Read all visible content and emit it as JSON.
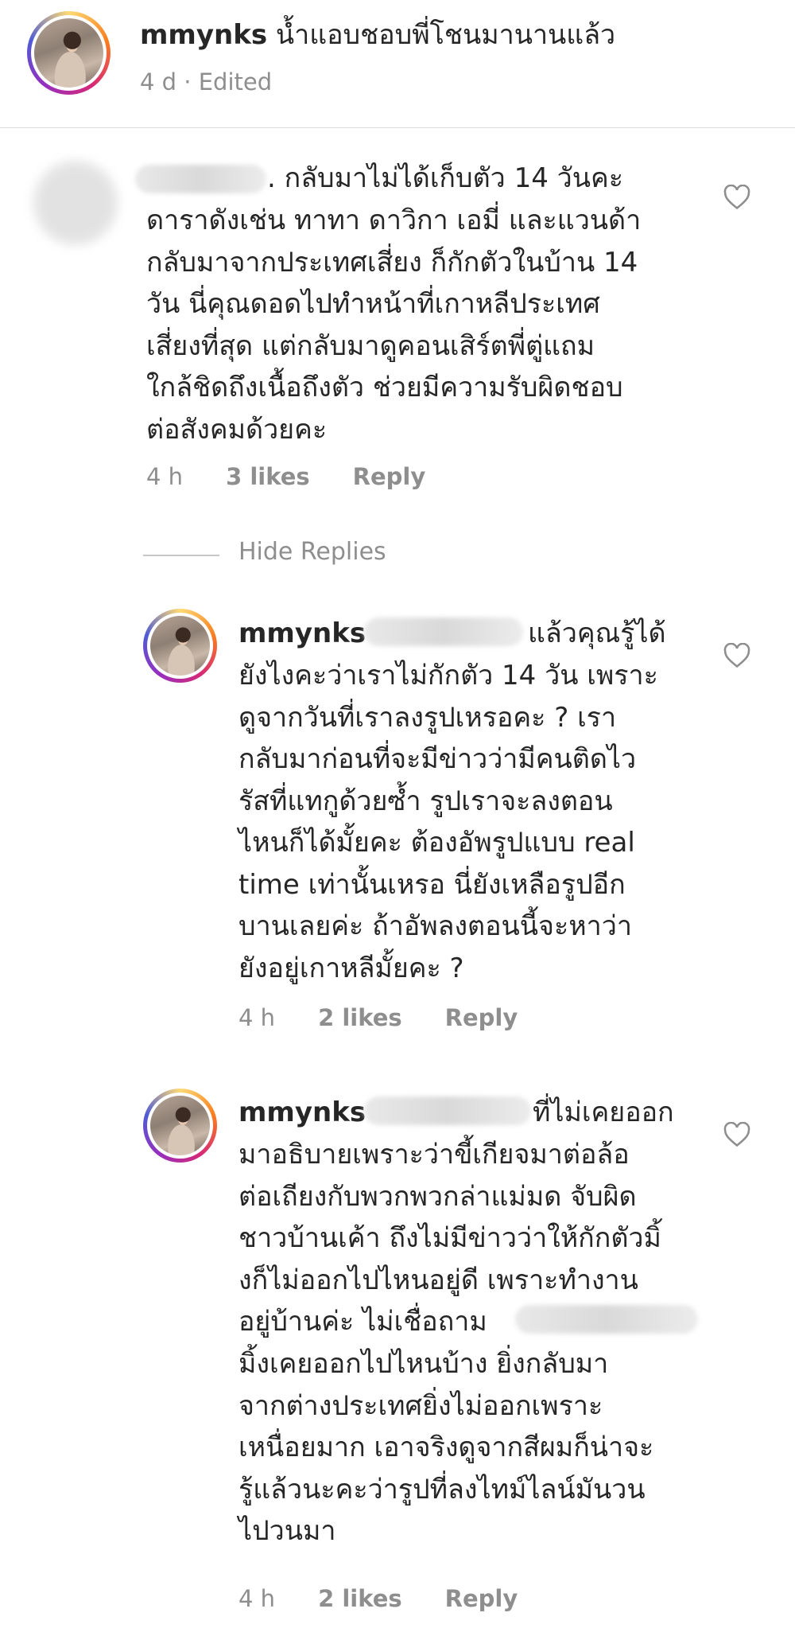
{
  "caption": {
    "username": "mmynks",
    "text": "น้ำแอบชอบพี่โชนมานานแล้ว",
    "time": "4 d",
    "edited": "Edited",
    "separator": " · "
  },
  "comments": [
    {
      "username": "",
      "line1": ". กลับมาไม่ได้เก็บตัว 14 วันคะ",
      "body": "ดาราดังเช่น ทาทา ดาวิกา เอมี่ และแวนด้า\nกลับมาจากประเทศเสี่ยง ก็กักตัวในบ้าน 14\nวัน นี่คุณดอดไปทำหน้าที่เกาหลีประเทศ\nเสี่ยงที่สุด แต่กลับมาดูคอนเสิร์ตพี่ตู่แถม\nใกล้ชิดถึงเนื้อถึงตัว ช่วยมีความรับผิดชอบ\nต่อสังคมด้วยคะ",
      "time": "4 h",
      "likes": "3 likes",
      "reply": "Reply"
    }
  ],
  "hide_replies": "Hide Replies",
  "replies": [
    {
      "username": "mmynks",
      "line1": "แล้วคุณรู้ได้",
      "body": "ยังไงคะว่าเราไม่กักตัว 14 วัน เพราะ\nดูจากวันที่เราลงรูปเหรอคะ ? เรา\nกลับมาก่อนที่จะมีข่าวว่ามีคนติดไว\nรัสที่แทกูด้วยซ้ำ รูปเราจะลงตอน\nไหนก็ได้มั้ยคะ ต้องอัพรูปแบบ real\ntime เท่านั้นเหรอ นี่ยังเหลือรูปอีก\nบานเลยค่ะ ถ้าอัพลงตอนนี้จะหาว่า\nยังอยู่เกาหลีมั้ยคะ ?",
      "time": "4 h",
      "likes": "2 likes",
      "reply": "Reply"
    },
    {
      "username": "mmynks",
      "line1": "ที่ไม่เคยออก",
      "body": "มาอธิบายเพราะว่าขี้เกียจมาต่อล้อ\nต่อเถียงกับพวกพวกล่าแม่มด จับผิด\nชาวบ้านเค้า ถึงไม่มีข่าวว่าให้กักตัวมิ้\nงก็ไม่ออกไปไหนอยู่ดี เพราะทำงาน",
      "line_mid": "อยู่บ้านค่ะ ไม่เชื่อถาม",
      "body2": "มิ้งเคยออกไปไหนบ้าง ยิ่งกลับมา\nจากต่างประเทศยิ่งไม่ออกเพราะ\nเหนื่อยมาก เอาจริงดูจากสีผมก็น่าจะ\nรู้แล้วนะคะว่ารูปที่ลงไทม์ไลน์มันวน\nไปวนมา",
      "time": "4 h",
      "likes": "2 likes",
      "reply": "Reply"
    }
  ],
  "icons": {
    "like": "heart-outline-icon"
  },
  "colors": {
    "text": "#262626",
    "meta": "#8e8e8e",
    "divider": "#dbdbdb"
  }
}
